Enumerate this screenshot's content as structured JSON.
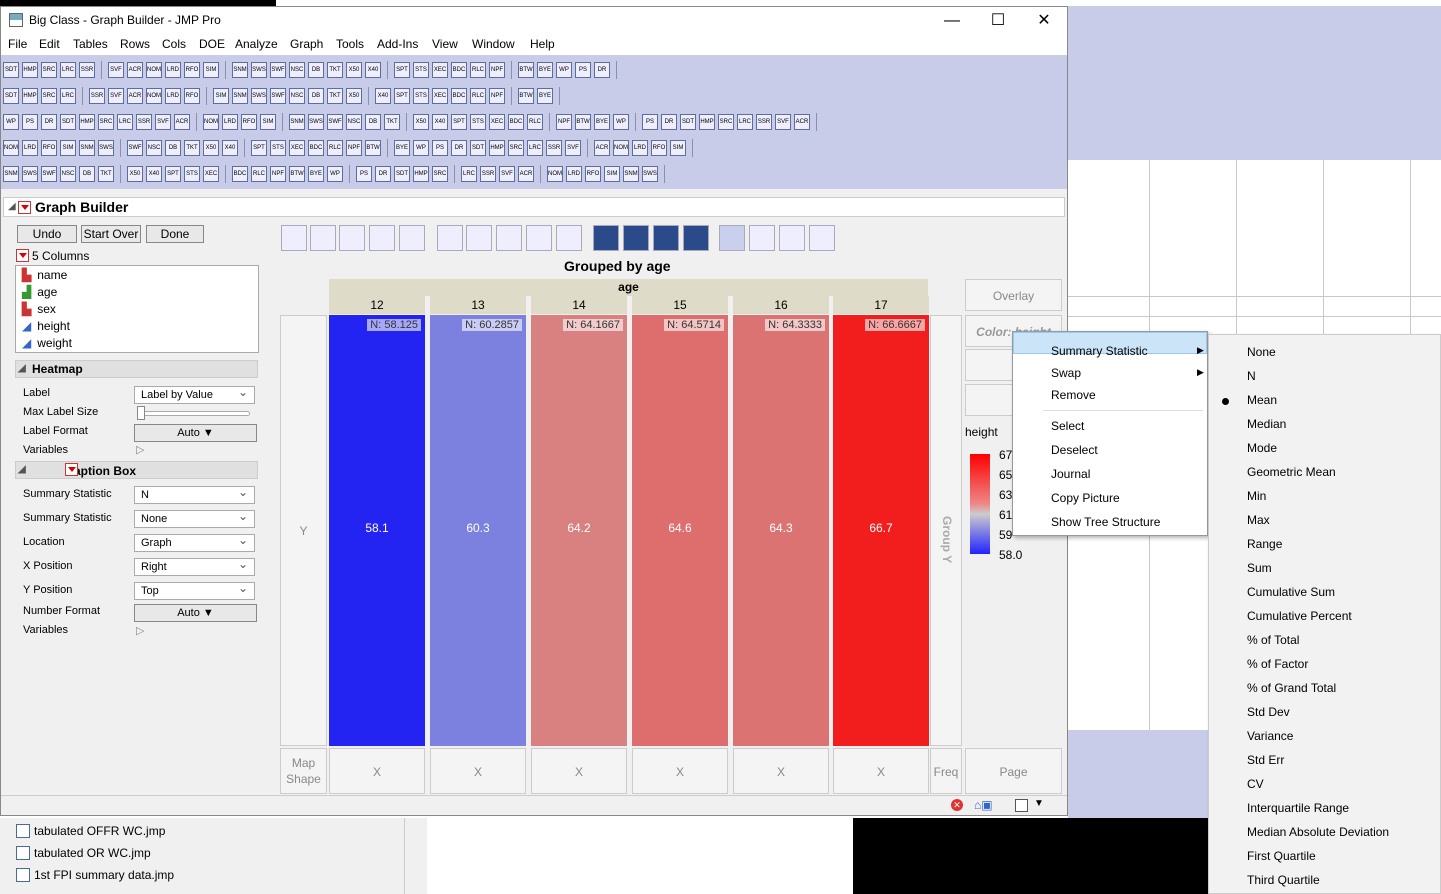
{
  "window": {
    "title": "Big Class - Graph Builder - JMP Pro",
    "min": "—",
    "max": "☐",
    "close": "✕"
  },
  "menus": [
    "File",
    "Edit",
    "Tables",
    "Rows",
    "Cols",
    "DOE",
    "Analyze",
    "Graph",
    "Tools",
    "Add-Ins",
    "View",
    "Window",
    "Help"
  ],
  "graph_builder": {
    "title": "Graph Builder",
    "undo": "Undo",
    "start_over": "Start Over",
    "done": "Done",
    "columns_header": "5 Columns",
    "columns": [
      "name",
      "age",
      "sex",
      "height",
      "weight"
    ]
  },
  "heatmap": {
    "title": "Heatmap",
    "label_lbl": "Label",
    "label_val": "Label by Value",
    "maxsize_lbl": "Max Label Size",
    "format_lbl": "Label Format",
    "format_val": "Auto",
    "variables_lbl": "Variables"
  },
  "caption": {
    "title": "Caption Box",
    "stat1_lbl": "Summary Statistic",
    "stat1_val": "N",
    "stat2_lbl": "Summary Statistic",
    "stat2_val": "None",
    "loc_lbl": "Location",
    "loc_val": "Graph",
    "xpos_lbl": "X Position",
    "xpos_val": "Right",
    "ypos_lbl": "Y Position",
    "ypos_val": "Top",
    "numfmt_lbl": "Number Format",
    "numfmt_val": "Auto",
    "variables_lbl": "Variables"
  },
  "chart": {
    "title": "Grouped by age",
    "group_label": "age",
    "y_zone": "Y",
    "map_zone": "Map Shape",
    "freq_zone": "Freq",
    "page_zone": "Page",
    "group_y": "Group Y",
    "overlay": "Overlay",
    "color": "Color: height",
    "x_label": "X",
    "bars": [
      {
        "cat": "12",
        "n": "N: 58.125",
        "val": "58.1",
        "color": "#2424f2"
      },
      {
        "cat": "13",
        "n": "N: 60.2857",
        "val": "60.3",
        "color": "#7c80de"
      },
      {
        "cat": "14",
        "n": "N: 64.1667",
        "val": "64.2",
        "color": "#d98080"
      },
      {
        "cat": "15",
        "n": "N: 64.5714",
        "val": "64.6",
        "color": "#de6e6e"
      },
      {
        "cat": "16",
        "n": "N: 64.3333",
        "val": "64.3",
        "color": "#dc7373"
      },
      {
        "cat": "17",
        "n": "N: 66.6667",
        "val": "66.7",
        "color": "#f21e1e"
      }
    ]
  },
  "legend": {
    "title": "height",
    "ticks": [
      "67",
      "65",
      "63",
      "61",
      "59",
      "58.0"
    ]
  },
  "context_menu": {
    "items": [
      "Summary Statistic",
      "Swap",
      "Remove",
      "Select",
      "Deselect",
      "Journal",
      "Copy Picture",
      "Show Tree Structure"
    ]
  },
  "submenu": {
    "items": [
      "None",
      "N",
      "Mean",
      "Median",
      "Mode",
      "Geometric Mean",
      "Min",
      "Max",
      "Range",
      "Sum",
      "Cumulative Sum",
      "Cumulative Percent",
      "% of Total",
      "% of Factor",
      "% of Grand Total",
      "Std Dev",
      "Variance",
      "Std Err",
      "CV",
      "Interquartile Range",
      "Median Absolute Deviation",
      "First Quartile",
      "Third Quartile"
    ],
    "selected": "Mean"
  },
  "files": [
    "tabulated OFFR WC.jmp",
    "tabulated OR WC.jmp",
    "1st FPI summary data.jmp"
  ],
  "toolbar_icons": [
    "SDT",
    "HMP",
    "SRC",
    "LRC",
    "SSR",
    "SVF",
    "ACR",
    "NOM",
    "LRD",
    "RFO",
    "SIM",
    "SNM",
    "SWS",
    "SWF",
    "NSC",
    "DB",
    "TKT",
    "X50",
    "X40",
    "SPT",
    "STS",
    "XEC",
    "BDC",
    "RLC",
    "NPF",
    "BTW",
    "BYE",
    "WP",
    "PS",
    "DR"
  ]
}
